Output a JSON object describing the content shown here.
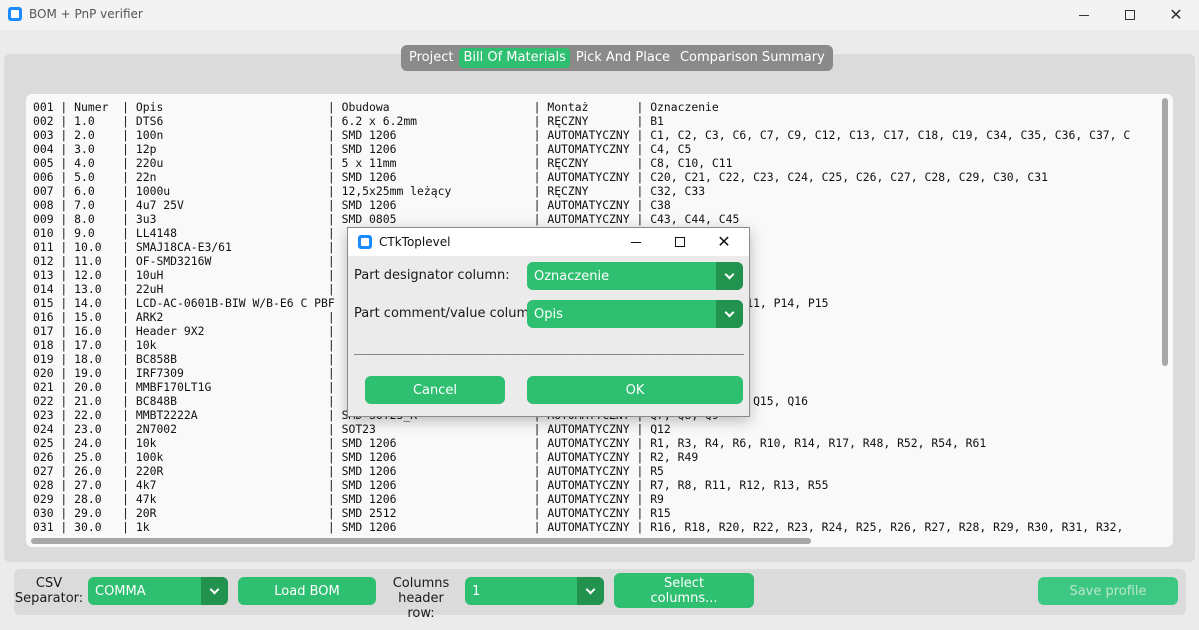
{
  "window": {
    "title": "BOM + PnP verifier",
    "minimize_glyph": "",
    "maximize_glyph": "",
    "close_glyph": "✕"
  },
  "tabs": [
    {
      "label": "Project",
      "active": false
    },
    {
      "label": "Bill Of Materials",
      "active": true
    },
    {
      "label": "Pick And Place",
      "active": false
    },
    {
      "label": "Comparison Summary",
      "active": false
    }
  ],
  "bom_lines": [
    "001 | Numer  | Opis                        | Obudowa                     | Montaż       | Oznaczenie",
    "002 | 1.0    | DTS6                        | 6.2 x 6.2mm                 | RĘCZNY       | B1",
    "003 | 2.0    | 100n                        | SMD 1206                    | AUTOMATYCZNY | C1, C2, C3, C6, C7, C9, C12, C13, C17, C18, C19, C34, C35, C36, C37, C",
    "004 | 3.0    | 12p                         | SMD 1206                    | AUTOMATYCZNY | C4, C5",
    "005 | 4.0    | 220u                        | 5 x 11mm                    | RĘCZNY       | C8, C10, C11",
    "006 | 5.0    | 22n                         | SMD 1206                    | AUTOMATYCZNY | C20, C21, C22, C23, C24, C25, C26, C27, C28, C29, C30, C31",
    "007 | 6.0    | 1000u                       | 12,5x25mm leżący            | RĘCZNY       | C32, C33",
    "008 | 7.0    | 4u7 25V                     | SMD 1206                    | AUTOMATYCZNY | C38",
    "009 | 8.0    | 3u3                         | SMD 0805                    | AUTOMATYCZNY | C43, C44, C45",
    "010 | 9.0    | LL4148                      |                             |              | D5, D6, D7",
    "011 | 10.0   | SMAJ18CA-E3/61              |                             |              |",
    "012 | 11.0   | OF-SMD3216W                 |                             |              | 1, D12",
    "013 | 12.0   | 10uH                        |                             |              |",
    "014 | 13.0   | 22uH                        |                             |              |",
    "015 | 14.0   | LCD-AC-0601B-BIW W/B-E6 C PBF                             |              | P8, P9, P10, P11, P14, P15",
    "016 | 15.0   | ARK2                        |                             |              |",
    "017 | 16.0   | Header 9X2                  |                             |              |",
    "018 | 17.0   | 10k                         |                             |              |",
    "019 | 18.0   | BC858B                      |                             |              |",
    "020 | 19.0   | IRF7309                     |                             |              |",
    "021 | 20.0   | MMBF170LT1G                 |                             |              |",
    "022 | 21.0   | BC848B                      |                             |              | Q11, Q13, Q14, Q15, Q16",
    "023 | 22.0   | MMBT2222A                   | SMD SOT23_R                 | AUTOMATYCZNY | Q7, Q8, Q9",
    "024 | 23.0   | 2N7002                      | SOT23                       | AUTOMATYCZNY | Q12",
    "025 | 24.0   | 10k                         | SMD 1206                    | AUTOMATYCZNY | R1, R3, R4, R6, R10, R14, R17, R48, R52, R54, R61",
    "026 | 25.0   | 100k                        | SMD 1206                    | AUTOMATYCZNY | R2, R49",
    "027 | 26.0   | 220R                        | SMD 1206                    | AUTOMATYCZNY | R5",
    "028 | 27.0   | 4k7                         | SMD 1206                    | AUTOMATYCZNY | R7, R8, R11, R12, R13, R55",
    "029 | 28.0   | 47k                         | SMD 1206                    | AUTOMATYCZNY | R9",
    "030 | 29.0   | 20R                         | SMD 2512                    | AUTOMATYCZNY | R15",
    "031 | 30.0   | 1k                          | SMD 1206                    | AUTOMATYCZNY | R16, R18, R20, R22, R23, R24, R25, R26, R27, R28, R29, R30, R31, R32,"
  ],
  "bottom": {
    "separator_label": "CSV\nSeparator:",
    "separator_value": "COMMA",
    "load_bom_label": "Load BOM",
    "header_row_label": "Columns\nheader row:",
    "header_row_value": "1",
    "select_columns_label": "Select\ncolumns...",
    "save_profile_label": "Save profile"
  },
  "dialog": {
    "title": "CTkToplevel",
    "designator_label": "Part designator column:",
    "designator_value": "Oznaczenie",
    "comment_label": "Part comment/value column:",
    "comment_value": "Opis",
    "separator_line": "______________________________________________________",
    "cancel_label": "Cancel",
    "ok_label": "OK"
  },
  "colors": {
    "accent": "#2fbf71",
    "accent_dark": "#22924f"
  }
}
